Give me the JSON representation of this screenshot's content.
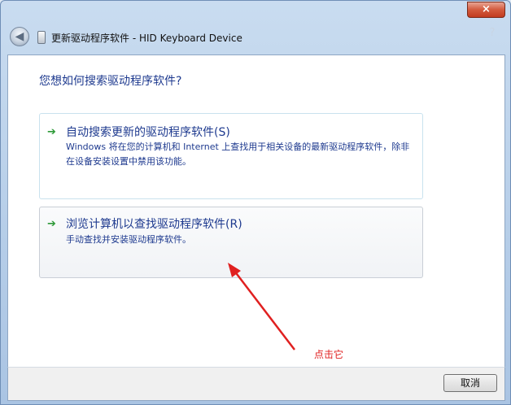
{
  "window": {
    "title": "更新驱动程序软件 - HID Keyboard Device",
    "close_label": "×",
    "back_label": "◀",
    "help_label": "?"
  },
  "content": {
    "question": "您想如何搜索驱动程序软件?",
    "options": [
      {
        "icon": "green-arrow-icon",
        "title": "自动搜索更新的驱动程序软件(S)",
        "description": "Windows 将在您的计算机和 Internet 上查找用于相关设备的最新驱动程序软件，除非在设备安装设置中禁用该功能。"
      },
      {
        "icon": "green-arrow-icon",
        "title": "浏览计算机以查找驱动程序软件(R)",
        "description": "手动查找并安装驱动程序软件。"
      }
    ]
  },
  "annotation": {
    "text": "点击它",
    "color": "#e02020"
  },
  "footer": {
    "cancel_label": "取消"
  }
}
